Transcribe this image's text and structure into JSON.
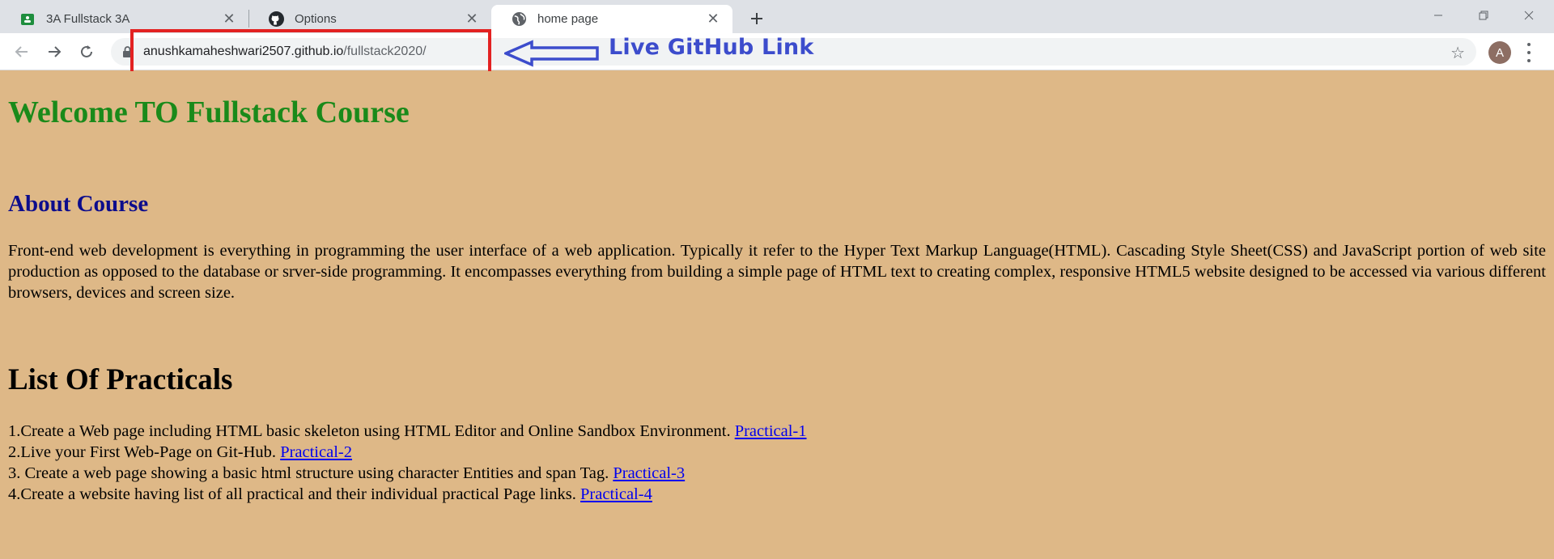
{
  "tabs": [
    {
      "label": "3A Fullstack 3A",
      "icon": "google-classroom-icon"
    },
    {
      "label": "Options",
      "icon": "github-icon"
    },
    {
      "label": "home page",
      "icon": "globe-icon"
    }
  ],
  "address_bar": {
    "host": "anushkamaheshwari2507.github.io",
    "path": "/fullstack2020/"
  },
  "profile": {
    "initial": "A"
  },
  "annotation": {
    "text": "Live GitHub Link",
    "color": "#3c4ccc",
    "box_color": "#e32222"
  },
  "page": {
    "background": "#deb887",
    "heading": "Welcome TO Fullstack Course",
    "about_title": "About Course",
    "about_text": "Front-end web development is everything in programming the user interface of a web application. Typically it refer to the Hyper Text Markup Language(HTML). Cascading Style Sheet(CSS) and JavaScript portion of web site production as opposed to the database or srver-side programming. It encompasses everything from building a simple page of HTML text to creating complex, responsive HTML5 website designed to be accessed via various different browsers, devices and screen size.",
    "practicals_title": "List Of Practicals",
    "practicals": [
      {
        "text": "1.Create a Web page including HTML basic skeleton using HTML Editor and Online Sandbox Environment. ",
        "link": "Practical-1"
      },
      {
        "text": "2.Live your First Web-Page on Git-Hub. ",
        "link": "Practical-2"
      },
      {
        "text": "3. Create a web page showing a basic html structure using character Entities and span Tag. ",
        "link": "Practical-3"
      },
      {
        "text": "4.Create a website having list of all practical and their individual practical Page links. ",
        "link": "Practical-4"
      }
    ]
  }
}
